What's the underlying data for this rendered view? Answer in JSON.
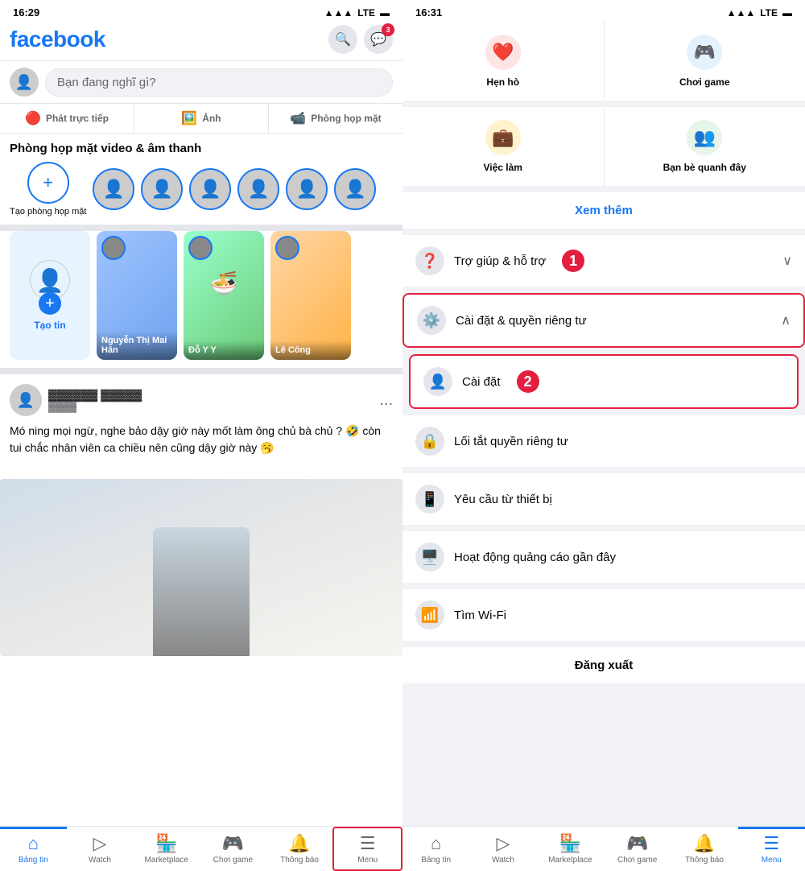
{
  "left": {
    "status_time": "16:29",
    "status_signal": "▲▲▲",
    "status_network": "LTE",
    "status_battery": "🔋",
    "logo": "facebook",
    "search_icon": "🔍",
    "messenger_icon": "💬",
    "messenger_badge": "3",
    "composer_placeholder": "Bạn đang nghĩ gì?",
    "action_live": "Phát trực tiếp",
    "action_photo": "Ảnh",
    "action_room": "Phòng họp mặt",
    "room_section_title": "Phòng họp mặt video & âm thanh",
    "create_room_label": "Tạo phòng họp mặt",
    "stories": [
      {
        "label": "Tạo tin",
        "type": "create"
      },
      {
        "label": "Nguyễn Thị Mai Hân",
        "type": "user"
      },
      {
        "label": "Đỗ Y Y",
        "type": "user"
      },
      {
        "label": "Lê Công",
        "type": "user"
      }
    ],
    "post": {
      "text": "Mó ning mọi ngừ, nghe bảo dậy giờ này mốt làm ông chủ bà chủ ? 🤣 còn tui chắc nhân viên ca chiều nên cũng dậy giờ này 🥱",
      "more": "..."
    },
    "nav": [
      {
        "label": "Bảng tin",
        "active": true
      },
      {
        "label": "Watch"
      },
      {
        "label": "Marketplace"
      },
      {
        "label": "Chơi game"
      },
      {
        "label": "Thông báo"
      },
      {
        "label": "Menu",
        "highlighted": true
      }
    ]
  },
  "right": {
    "status_time": "16:31",
    "status_signal": "▲▲▲",
    "status_network": "LTE",
    "status_battery": "🔋",
    "menu_items_top": [
      {
        "label": "Hẹn hò",
        "icon": "❤️",
        "color": "heart"
      },
      {
        "label": "Việc làm",
        "icon": "💼",
        "color": "work"
      }
    ],
    "menu_items_right": [
      {
        "label": "Chơi game",
        "icon": "🎮",
        "color": "game"
      },
      {
        "label": "Bạn bè quanh đây",
        "icon": "👥",
        "color": "people"
      }
    ],
    "see_more": "Xem thêm",
    "help_label": "Trợ giúp & hỗ trợ",
    "step1": "1",
    "settings_label": "Cài đặt & quyền riêng tư",
    "step2": "2",
    "settings_sub_label": "Cài đặt",
    "privacy_shortcut": "Lối tắt quyền riêng tư",
    "device_request": "Yêu cầu từ thiết bị",
    "ad_activity": "Hoạt động quảng cáo gần đây",
    "wifi": "Tìm Wi-Fi",
    "logout": "Đăng xuất",
    "nav": [
      {
        "label": "Bảng tin"
      },
      {
        "label": "Watch"
      },
      {
        "label": "Marketplace"
      },
      {
        "label": "Chơi game"
      },
      {
        "label": "Thông báo"
      },
      {
        "label": "Menu",
        "active": true
      }
    ]
  }
}
